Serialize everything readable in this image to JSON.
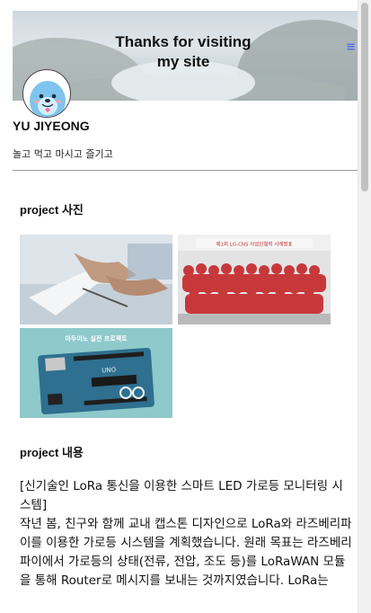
{
  "banner": {
    "title_line1": "Thanks for visiting",
    "title_line2": "my site",
    "menu_icon": "hamburger-menu-icon"
  },
  "profile": {
    "name": "YU JIYEONG",
    "tagline": "놀고 먹고 마시고 즐기고"
  },
  "sections": {
    "photos_title": "project 사진",
    "content_title": "project 내용"
  },
  "photos": [
    {
      "name": "business-handshake-photo"
    },
    {
      "name": "team-group-photo",
      "caption": "제1회 LG-CNS 사업단협력 사례발표"
    },
    {
      "name": "arduino-project-photo",
      "caption": "아두이노 실전 프로젝트",
      "board_text": "UNO"
    }
  ],
  "content": {
    "heading": "[신기술인 LoRa 통신을 이용한 스마트 LED 가로등 모니터링 시스템]",
    "body": "작년 봄, 친구와 함께 교내 캡스톤 디자인으로 LoRa와 라즈베리파이를 이용한 가로등 시스템을 계획했습니다. 원래 목표는 라즈베리파이에서 가로등의 상태(전류, 전압, 조도 등)를 LoRaWAN 모듈을 통해 Router로 메시지를 보내는 것까지였습니다. LoRa는"
  },
  "colors": {
    "accent": "#5a6cf0",
    "divider": "#999999",
    "arduino_bg": "#8ec9cb",
    "arduino_board": "#2f6f8f"
  }
}
